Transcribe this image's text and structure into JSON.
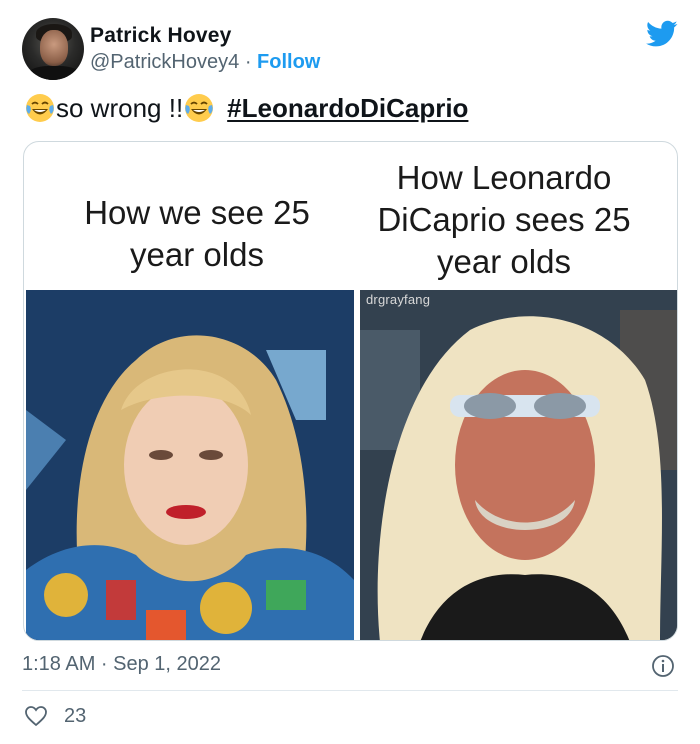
{
  "author": {
    "display_name": "Patrick Hovey",
    "handle": "@PatrickHovey4",
    "separator": "·",
    "follow_label": "Follow"
  },
  "tweet": {
    "text": "so wrong !!",
    "hashtag": "#LeonardoDiCaprio",
    "emoji": "face-with-tears-of-joy"
  },
  "media": {
    "caption_left": "How we see 25 year olds",
    "caption_right": "How Leonardo DiCaprio sees 25 year olds",
    "watermark": "drgrayfang"
  },
  "meta": {
    "timestamp": "1:18 AM · Sep 1, 2022"
  },
  "actions": {
    "like_count": "23"
  },
  "colors": {
    "accent": "#1d9bf0",
    "secondary_text": "#536471",
    "primary_text": "#0f1419"
  },
  "icons": {
    "brand": "twitter-bird-icon",
    "info": "info-icon",
    "like": "heart-icon"
  }
}
